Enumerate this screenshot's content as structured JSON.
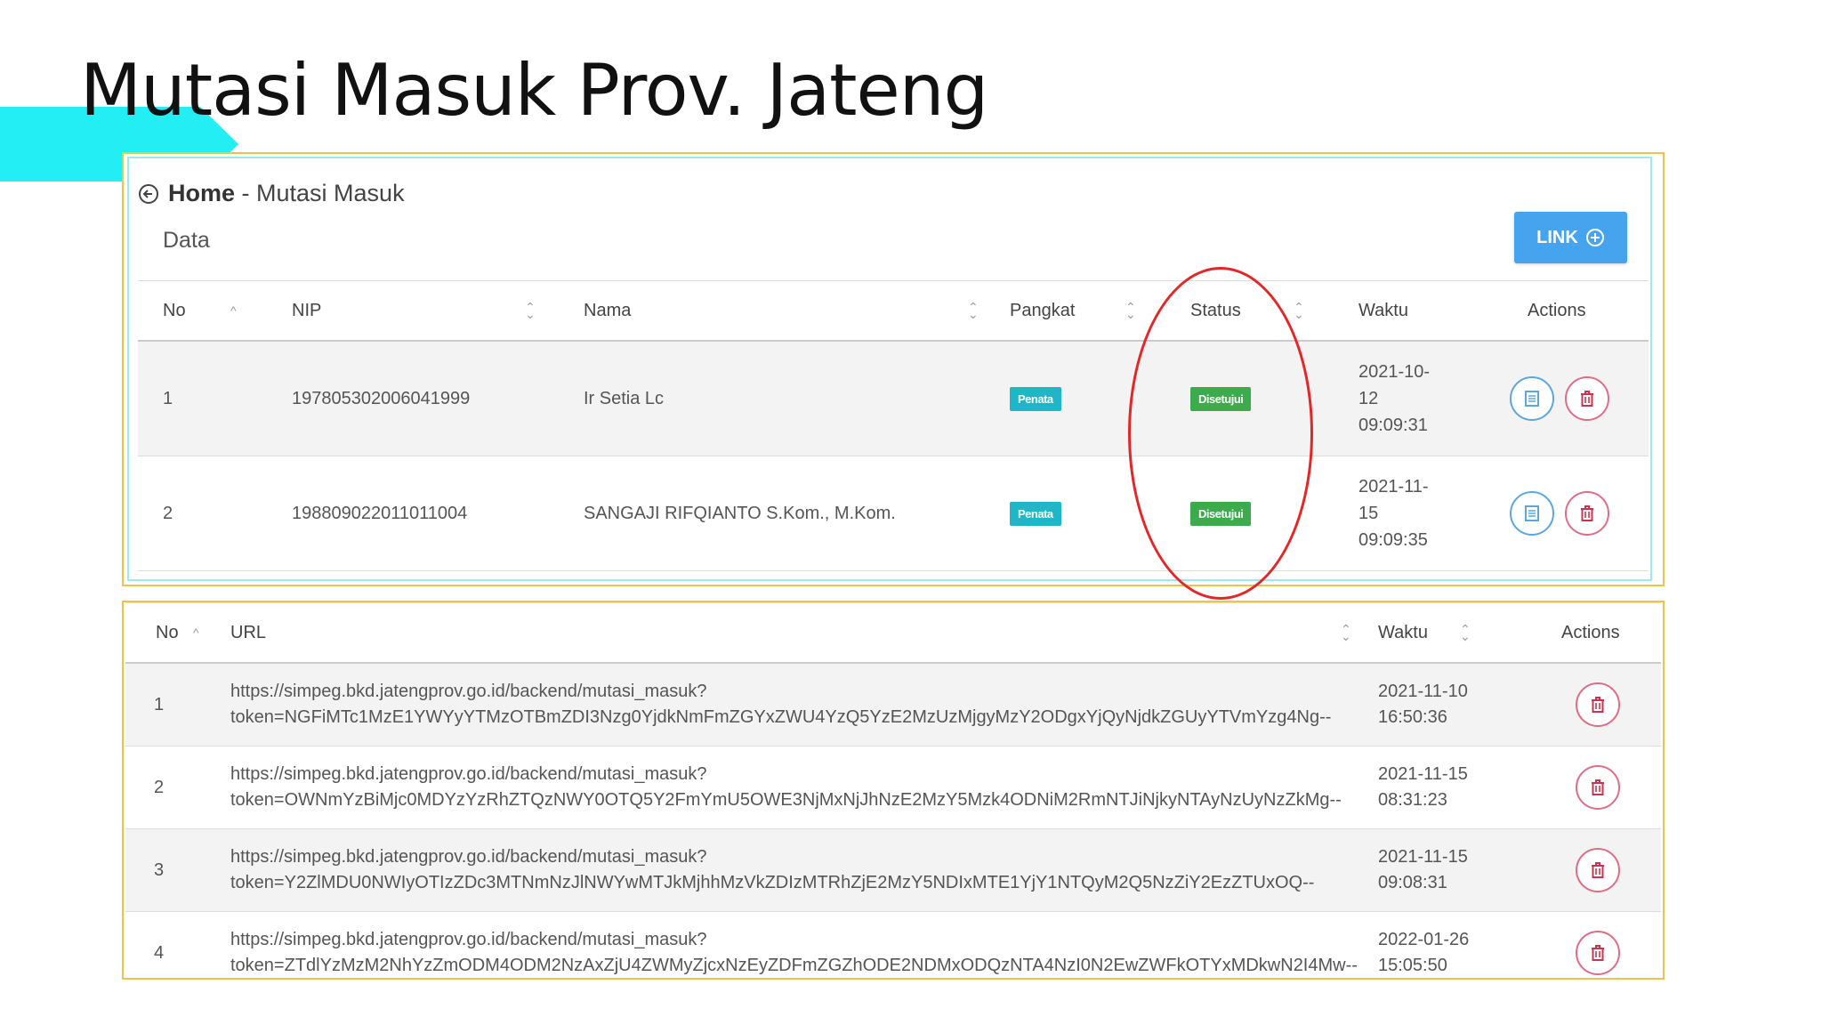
{
  "slide": {
    "title": "Mutasi Masuk Prov. Jateng"
  },
  "panel1": {
    "breadcrumb_home": "Home",
    "breadcrumb_sep": " - ",
    "breadcrumb_page": "Mutasi Masuk",
    "section_label": "Data",
    "link_button": "LINK",
    "columns": [
      "No",
      "NIP",
      "Nama",
      "Pangkat",
      "Status",
      "Waktu",
      "Actions"
    ],
    "rows": [
      {
        "no": "1",
        "nip": "197805302006041999",
        "nama": "Ir Setia Lc",
        "pangkat": "Penata",
        "status": "Disetujui",
        "waktu": [
          "2021-10-",
          "12",
          "09:09:31"
        ]
      },
      {
        "no": "2",
        "nip": "198809022011011004",
        "nama": "SANGAJI RIFQIANTO S.Kom., M.Kom.",
        "pangkat": "Penata",
        "status": "Disetujui",
        "waktu": [
          "2021-11-",
          "15",
          "09:09:35"
        ]
      }
    ]
  },
  "panel2": {
    "columns": [
      "No",
      "URL",
      "Waktu",
      "Actions"
    ],
    "rows": [
      {
        "no": "1",
        "url1": "https://simpeg.bkd.jatengprov.go.id/backend/mutasi_masuk?",
        "url2": "token=NGFiMTc1MzE1YWYyYTMzOTBmZDI3Nzg0YjdkNmFmZGYxZWU4YzQ5YzE2MzUzMjgyMzY2ODgxYjQyNjdkZGUyYTVmYzg4Ng--",
        "waktu1": "2021-11-10",
        "waktu2": "16:50:36"
      },
      {
        "no": "2",
        "url1": "https://simpeg.bkd.jatengprov.go.id/backend/mutasi_masuk?",
        "url2": "token=OWNmYzBiMjc0MDYzYzRhZTQzNWY0OTQ5Y2FmYmU5OWE3NjMxNjJhNzE2MzY5Mzk4ODNiM2RmNTJiNjkyNTAyNzUyNzZkMg--",
        "waktu1": "2021-11-15",
        "waktu2": "08:31:23"
      },
      {
        "no": "3",
        "url1": "https://simpeg.bkd.jatengprov.go.id/backend/mutasi_masuk?",
        "url2": "token=Y2ZlMDU0NWIyOTIzZDc3MTNmNzJlNWYwMTJkMjhhMzVkZDIzMTRhZjE2MzY5NDIxMTE1YjY1NTQyM2Q5NzZiY2EzZTUxOQ--",
        "waktu1": "2021-11-15",
        "waktu2": "09:08:31"
      },
      {
        "no": "4",
        "url1": "https://simpeg.bkd.jatengprov.go.id/backend/mutasi_masuk?",
        "url2": "token=ZTdlYzMzM2NhYzZmODM4ODM2NzAxZjU4ZWMyZjcxNzEyZDFmZGZhODE2NDMxODQzNTA4NzI0N2EwZWFkOTYxMDkwN2I4Mw--",
        "waktu1": "2022-01-26",
        "waktu2": "15:05:50"
      }
    ]
  },
  "colors": {
    "accent": "#22eef4",
    "link_button": "#46a3ee",
    "badge_pangkat": "#1fb7c7",
    "badge_status": "#3cab4c",
    "highlight": "#e52626",
    "panel_border": "#f0c24a"
  },
  "icons": {
    "back": "arrow-left-circle-icon",
    "link": "plus-circle-icon",
    "detail": "document-icon",
    "delete": "trash-icon",
    "sort": "sort-icon"
  }
}
